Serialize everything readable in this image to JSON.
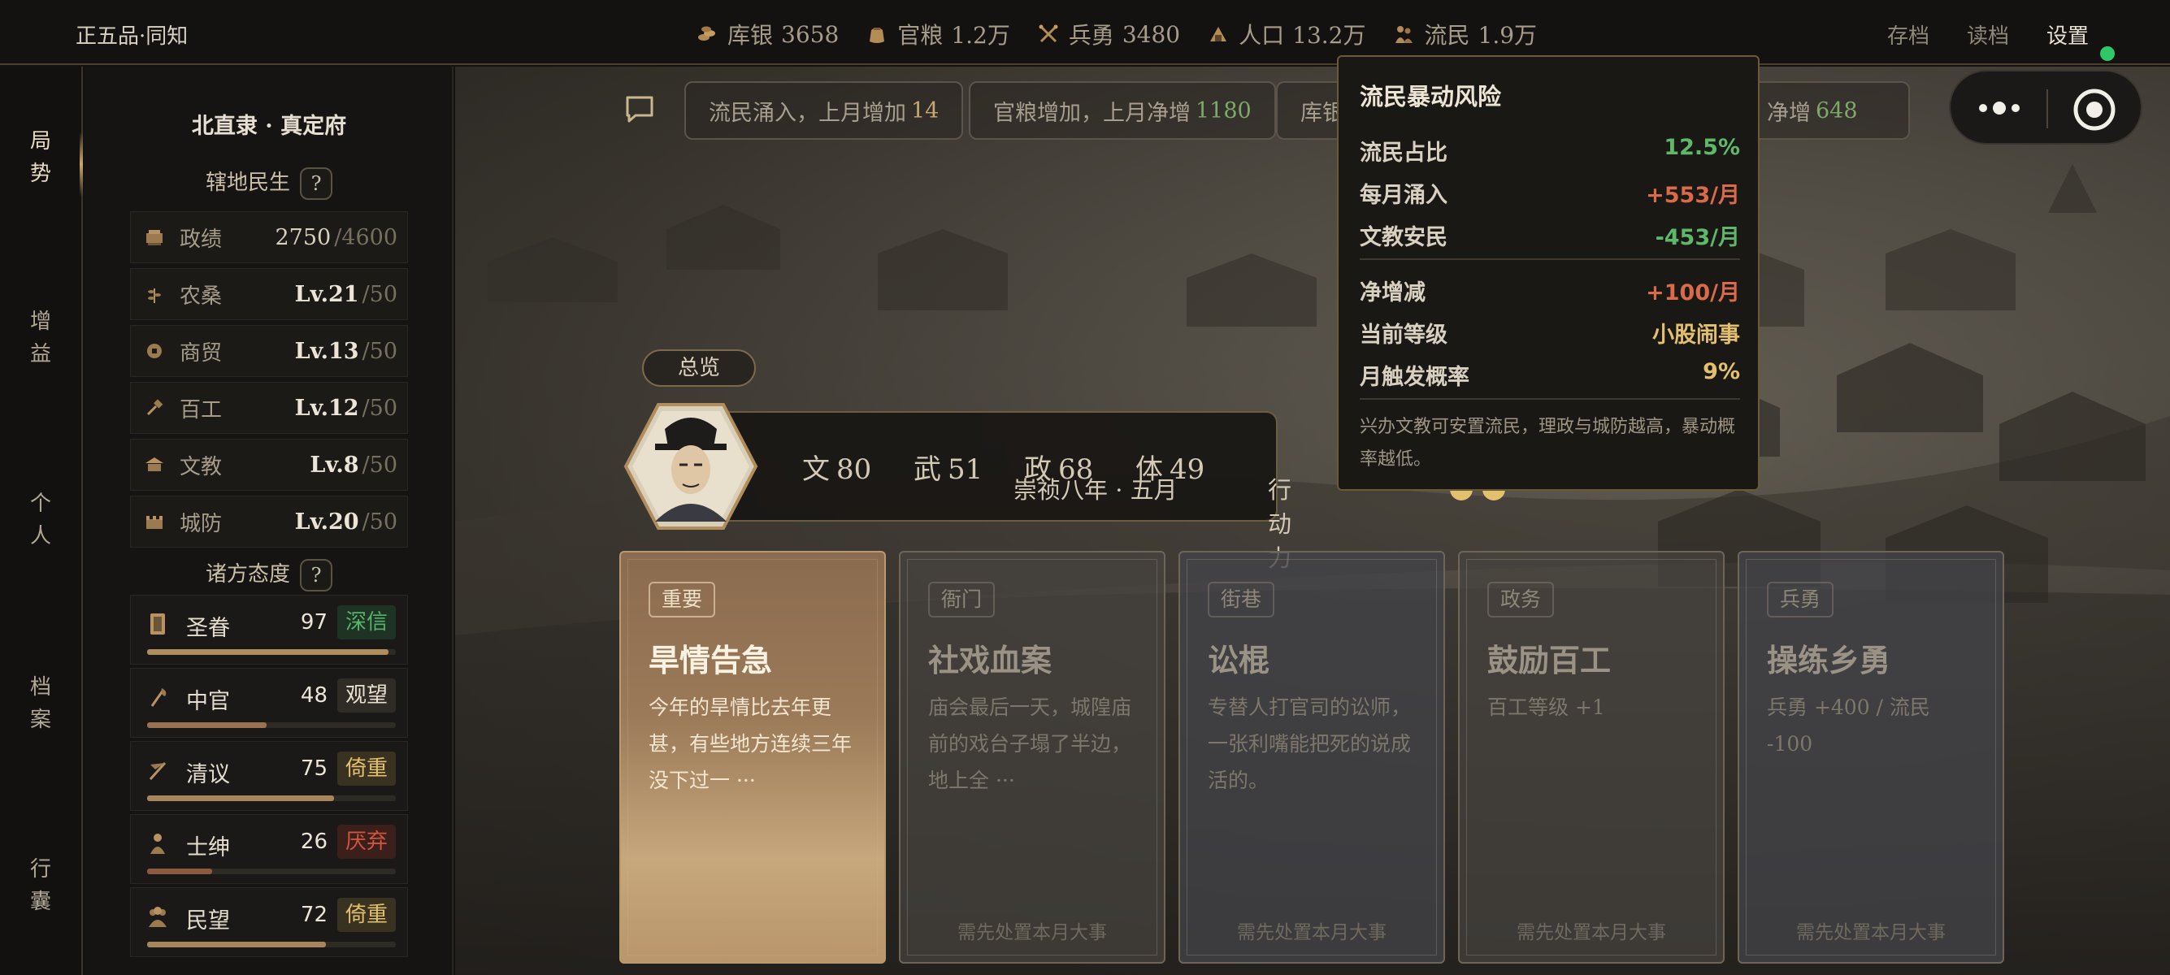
{
  "topbar": {
    "rank": "正五品·同知",
    "resources": [
      {
        "icon": "silver-coins-icon",
        "label": "库银",
        "value": "3658"
      },
      {
        "icon": "grain-sack-icon",
        "label": "官粮",
        "value": "1.2万"
      },
      {
        "icon": "crossed-weapons-icon",
        "label": "兵勇",
        "value": "3480"
      },
      {
        "icon": "population-icon",
        "label": "人口",
        "value": "13.2万"
      },
      {
        "icon": "refugee-icon",
        "label": "流民",
        "value": "1.9万"
      }
    ],
    "menu": [
      "存档",
      "读档",
      "设置"
    ],
    "status_color": "#2ec866"
  },
  "leftnav": {
    "items": [
      "局势",
      "增益",
      "个人",
      "档案",
      "行囊"
    ],
    "active_index": 0
  },
  "sidebar": {
    "region": "北直隶 · 真定府",
    "civil_title": "辖地民生",
    "help": "?",
    "stats": [
      {
        "icon": "achievement-icon",
        "name": "政绩",
        "value": "2750",
        "max": "/4600"
      },
      {
        "icon": "farming-icon",
        "name": "农桑",
        "value": "Lv.21",
        "max": "/50"
      },
      {
        "icon": "trade-icon",
        "name": "商贸",
        "value": "Lv.13",
        "max": "/50"
      },
      {
        "icon": "craft-icon",
        "name": "百工",
        "value": "Lv.12",
        "max": "/50"
      },
      {
        "icon": "education-icon",
        "name": "文教",
        "value": "Lv.8",
        "max": "/50"
      },
      {
        "icon": "city-wall-icon",
        "name": "城防",
        "value": "Lv.20",
        "max": "/50"
      }
    ],
    "faction_title": "诸方态度",
    "factions": [
      {
        "icon": "imperial-scroll-icon",
        "name": "圣眷",
        "value": 97,
        "tag": "深信",
        "tag_color": "#57b36b",
        "tag_bg": "#1f3324",
        "bar_color": "#b08d5c"
      },
      {
        "icon": "eunuch-whisk-icon",
        "name": "中官",
        "value": 48,
        "tag": "观望",
        "tag_color": "#e8e0cf",
        "tag_bg": "#2f2b25",
        "bar_color": "#9a7250"
      },
      {
        "icon": "scholar-brush-icon",
        "name": "清议",
        "value": 75,
        "tag": "倚重",
        "tag_color": "#e3c06e",
        "tag_bg": "#3a3220",
        "bar_color": "#a8865c"
      },
      {
        "icon": "gentry-figure-icon",
        "name": "士绅",
        "value": 26,
        "tag": "厌弃",
        "tag_color": "#d0543f",
        "tag_bg": "#3a1f1a",
        "bar_color": "#8c5a40"
      },
      {
        "icon": "people-crowd-icon",
        "name": "民望",
        "value": 72,
        "tag": "倚重",
        "tag_color": "#e3c06e",
        "tag_bg": "#3a3220",
        "bar_color": "#a8865c"
      }
    ]
  },
  "tickers": [
    {
      "text": "流民涌入，上月增加",
      "num": "14",
      "num_color": "#c7a873"
    },
    {
      "text": "官粮增加，上月净增",
      "num": "1180",
      "num_color": "#7ea86a"
    },
    {
      "text": "库银",
      "num": "",
      "num_color": "#7ea86a"
    },
    {
      "text": "净增",
      "num": "648",
      "num_color": "#7ea86a"
    }
  ],
  "overview": {
    "chip": "总览",
    "attrs": [
      {
        "label": "文",
        "value": "80"
      },
      {
        "label": "武",
        "value": "51"
      },
      {
        "label": "政",
        "value": "68"
      },
      {
        "label": "体",
        "value": "49"
      }
    ],
    "date": "崇祯八年 · 五月",
    "action_label": "行动力",
    "action_points": 2
  },
  "cards": [
    {
      "tag": "重要",
      "title": "旱情告急",
      "desc": "今年的旱情比去年更甚，有些地方连续三年没下过一 ···",
      "foot": "",
      "state": "active"
    },
    {
      "tag": "衙门",
      "title": "社戏血案",
      "desc": "庙会最后一天，城隍庙前的戏台子塌了半边，地上全 ···",
      "foot": "需先处置本月大事",
      "state": "dim"
    },
    {
      "tag": "街巷",
      "title": "讼棍",
      "desc": "专替人打官司的讼师，一张利嘴能把死的说成活的。",
      "foot": "需先处置本月大事",
      "state": "blue"
    },
    {
      "tag": "政务",
      "title": "鼓励百工",
      "desc": "百工等级 +1",
      "foot": "需先处置本月大事",
      "state": "dim"
    },
    {
      "tag": "兵勇",
      "title": "操练乡勇",
      "desc": "兵勇 +400 / 流民 -100",
      "foot": "需先处置本月大事",
      "state": "dim"
    }
  ],
  "tooltip": {
    "title": "流民暴动风险",
    "rows": [
      {
        "k": "流民占比",
        "v": "12.5%",
        "color": "#5fb86a"
      },
      {
        "k": "每月涌入",
        "v": "+553/月",
        "color": "#d96a4a"
      },
      {
        "k": "文教安民",
        "v": "-453/月",
        "color": "#5fb86a"
      },
      {
        "k": "净增减",
        "v": "+100/月",
        "color": "#d96a4a"
      },
      {
        "k": "当前等级",
        "v": "小股闹事",
        "color": "#e3c06e"
      },
      {
        "k": "月触发概率",
        "v": "9%",
        "color": "#e3c06e"
      }
    ],
    "note": "兴办文教可安置流民，理政与城防越高，暴动概率越低。"
  }
}
